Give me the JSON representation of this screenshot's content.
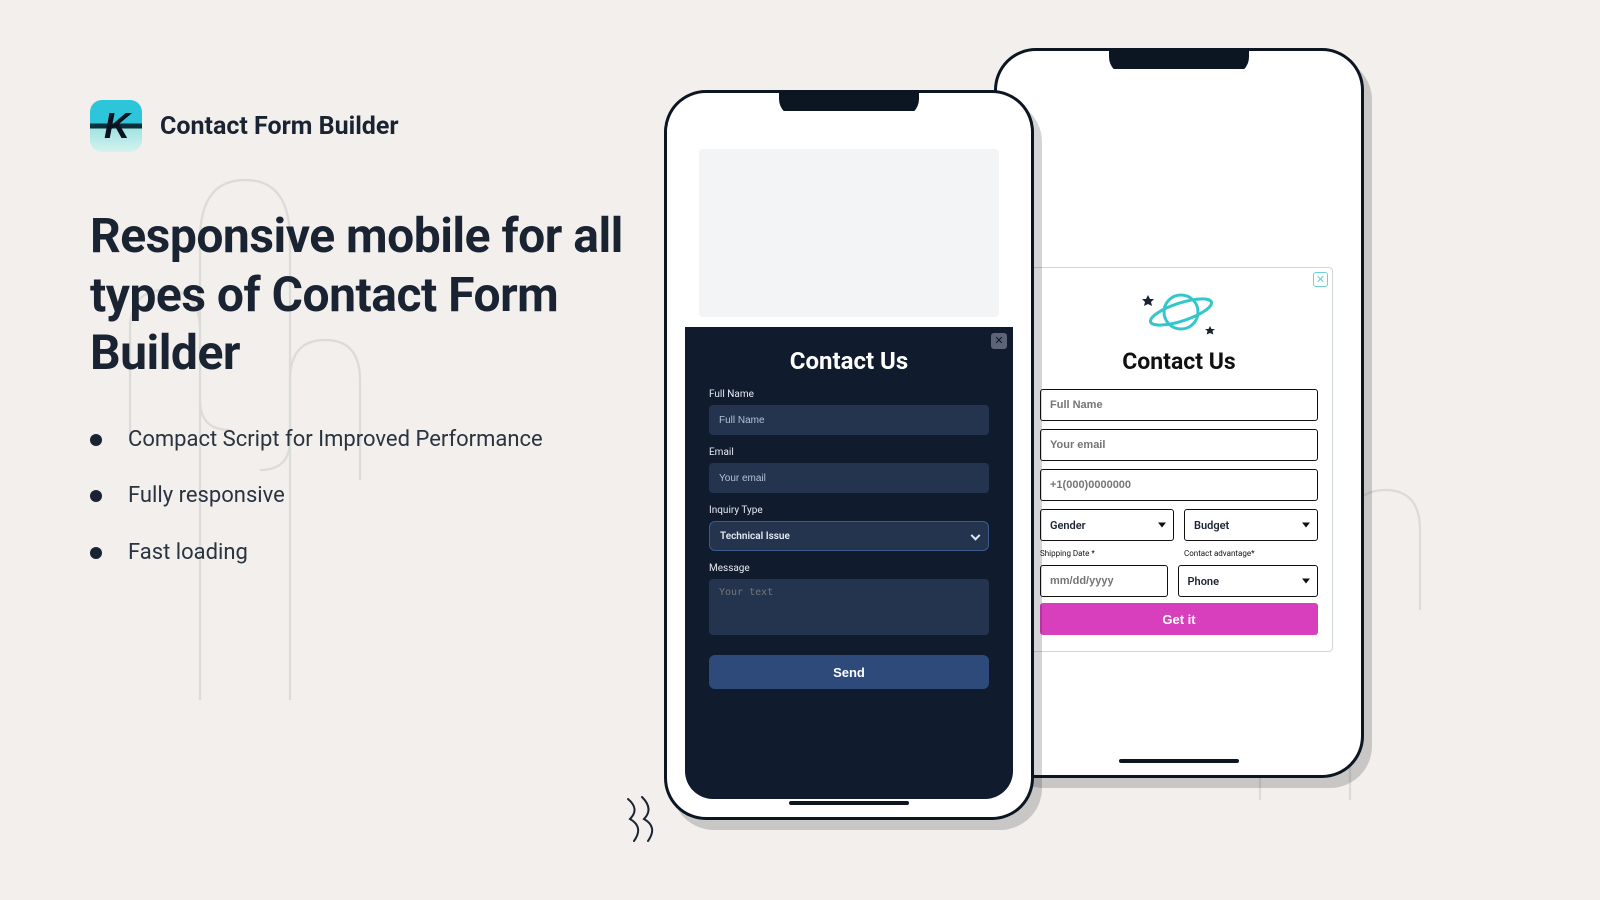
{
  "brand": {
    "logo_letter": "K",
    "title": "Contact Form Builder"
  },
  "headline": "Responsive mobile for all types of Contact Form Builder",
  "bullets": [
    "Compact Script for Improved Performance",
    "Fully responsive",
    "Fast loading"
  ],
  "phone_a": {
    "form_title": "Contact Us",
    "fields": {
      "fullname": {
        "label": "Full Name",
        "placeholder": "Full Name"
      },
      "email": {
        "label": "Email",
        "placeholder": "Your email"
      },
      "inquiry": {
        "label": "Inquiry Type",
        "value": "Technical Issue"
      },
      "message": {
        "label": "Message",
        "placeholder": "Your text"
      }
    },
    "submit_label": "Send"
  },
  "phone_b": {
    "form_title": "Contact Us",
    "fields": {
      "fullname": {
        "placeholder": "Full Name"
      },
      "email": {
        "placeholder": "Your email"
      },
      "phone": {
        "placeholder": "+1(000)0000000"
      },
      "gender": {
        "value": "Gender"
      },
      "budget": {
        "value": "Budget"
      },
      "shipdate": {
        "label": "Shipping Date *",
        "placeholder": "mm/dd/yyyy"
      },
      "contact": {
        "label": "Contact advantage*",
        "value": "Phone"
      }
    },
    "submit_label": "Get it"
  },
  "colors": {
    "dark_panel": "#101b2e",
    "accent_pink": "#d83fbc",
    "brand_teal": "#2dc5d9"
  }
}
